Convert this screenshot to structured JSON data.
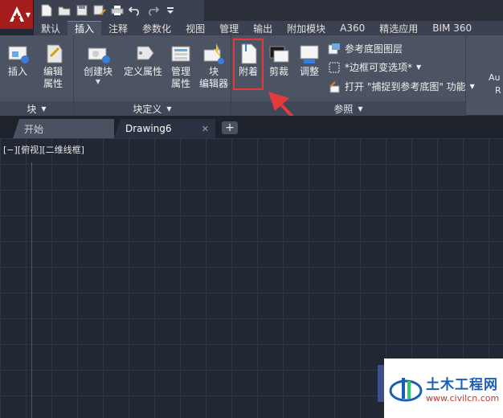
{
  "titlebar": {
    "qat_icons": [
      "new-file-icon",
      "open-folder-icon",
      "save-icon",
      "save-as-icon",
      "print-icon",
      "undo-icon",
      "redo-icon",
      "customize-qat-icon"
    ]
  },
  "tabs": [
    "默认",
    "插入",
    "注释",
    "参数化",
    "视图",
    "管理",
    "输出",
    "附加模块",
    "A360",
    "精选应用",
    "BIM 360"
  ],
  "active_tab": "插入",
  "ribbon": {
    "block_panel": {
      "title": "块",
      "insert_label": "插入",
      "edit_attr_label": "编辑\n属性"
    },
    "block_def_panel": {
      "title": "块定义",
      "create_block_label": "创建块",
      "define_attr_label": "定义属性",
      "manage_attr_label": "管理\n属性",
      "block_editor_label": "块\n编辑器"
    },
    "reference_panel": {
      "title": "参照",
      "attach_label": "附着",
      "clip_label": "剪裁",
      "adjust_label": "调整",
      "underlay_layers_label": "参考底图图层",
      "frame_option_label": "*边框可变选项*",
      "snap_label": "打开  \"捕捉到参考底图\"  功能"
    },
    "overflow_label_1": "Au",
    "overflow_label_2": "R"
  },
  "file_tabs": {
    "start": "开始",
    "drawing": "Drawing6",
    "add": "+"
  },
  "viewport_label": "[−][俯视][二维线框]",
  "watermark": {
    "title": "土木工程网",
    "url": "www.civilcn.com"
  },
  "colors": {
    "accent_red": "#e53a3a",
    "app_red": "#a51c1c",
    "ribbon_bg": "#4c5464",
    "canvas_bg": "#212733"
  }
}
